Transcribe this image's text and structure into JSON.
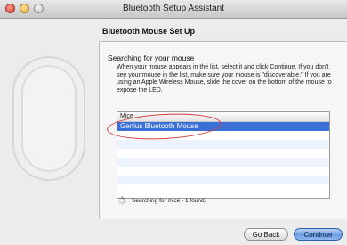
{
  "window": {
    "title": "Bluetooth Setup Assistant"
  },
  "page": {
    "heading": "Bluetooth Mouse Set Up",
    "section_title": "Searching for your mouse",
    "instructions": "When your mouse appears in the list, select it and click Continue. If you don't see your mouse in the list, make sure your mouse is \"discoverable.\" If you are using an Apple Wireless Mouse, slide the cover on the bottom of the mouse to expose the LED."
  },
  "device_list": {
    "header": "Mice",
    "items": [
      "Genius Bluetooth Mouse"
    ],
    "selected_index": 0
  },
  "status": {
    "text": "Searching for mice - 1 found."
  },
  "buttons": {
    "back": "Go Back",
    "continue": "Continue"
  },
  "colors": {
    "selection": "#3a6fd8",
    "highlight_circle": "#d23b3b",
    "continue_button": "#6d9ee3"
  }
}
